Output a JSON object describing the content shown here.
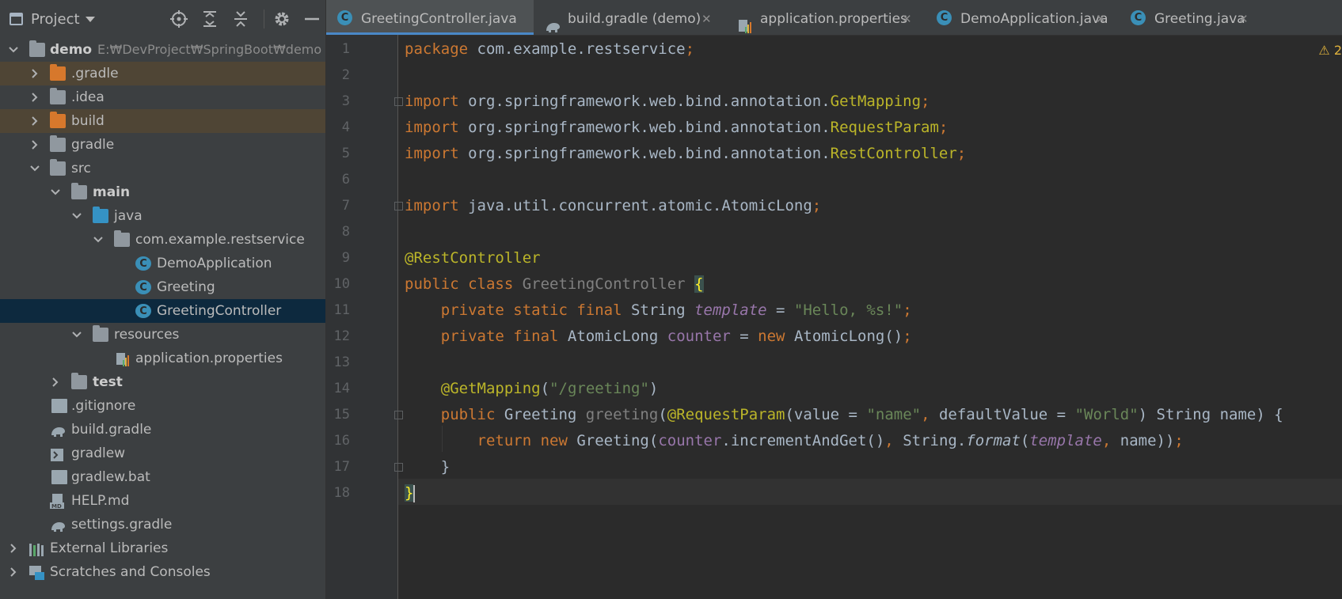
{
  "sidebar": {
    "title": "Project",
    "tree": [
      {
        "label": "demo",
        "sub": "E:₩DevProject₩SpringBoot₩demo",
        "bold": true
      },
      {
        "label": ".gradle"
      },
      {
        "label": ".idea"
      },
      {
        "label": "build"
      },
      {
        "label": "gradle"
      },
      {
        "label": "src"
      },
      {
        "label": "main",
        "bold": true
      },
      {
        "label": "java"
      },
      {
        "label": "com.example.restservice"
      },
      {
        "label": "DemoApplication"
      },
      {
        "label": "Greeting"
      },
      {
        "label": "GreetingController"
      },
      {
        "label": "resources"
      },
      {
        "label": "application.properties"
      },
      {
        "label": "test",
        "bold": true
      },
      {
        "label": ".gitignore"
      },
      {
        "label": "build.gradle"
      },
      {
        "label": "gradlew"
      },
      {
        "label": "gradlew.bat"
      },
      {
        "label": "HELP.md"
      },
      {
        "label": "settings.gradle"
      },
      {
        "label": "External Libraries"
      },
      {
        "label": "Scratches and Consoles"
      }
    ]
  },
  "tabs": [
    {
      "label": "GreetingController.java",
      "active": true
    },
    {
      "label": "build.gradle (demo)"
    },
    {
      "label": "application.properties"
    },
    {
      "label": "DemoApplication.java"
    },
    {
      "label": "Greeting.java"
    }
  ],
  "editor": {
    "warning_count": "2",
    "line_numbers": [
      "1",
      "2",
      "3",
      "4",
      "5",
      "6",
      "7",
      "8",
      "9",
      "10",
      "11",
      "12",
      "13",
      "14",
      "15",
      "16",
      "17",
      "18"
    ],
    "code": {
      "l1_kw": "package",
      "l1_rest": " com.example.restservice",
      "l1_semi": ";",
      "l3_kw": "import",
      "l3_pkg": " org.springframework.web.bind.annotation.",
      "l3_cls": "GetMapping",
      "l3_semi": ";",
      "l4_kw": "import",
      "l4_pkg": " org.springframework.web.bind.annotation.",
      "l4_cls": "RequestParam",
      "l4_semi": ";",
      "l5_kw": "import",
      "l5_pkg": " org.springframework.web.bind.annotation.",
      "l5_cls": "RestController",
      "l5_semi": ";",
      "l7_kw": "import",
      "l7_pkg": " java.util.concurrent.atomic.AtomicLong",
      "l7_semi": ";",
      "l9_ann": "@RestController",
      "l10_kw": "public class ",
      "l10_name": "GreetingController",
      "l10_sp": " ",
      "l10_brace": "{",
      "l11_kw": "private static final ",
      "l11_type": "String ",
      "l11_fld": "template",
      "l11_eq": " = ",
      "l11_str": "\"Hello, %s!\"",
      "l11_semi": ";",
      "l12_kw": "private final ",
      "l12_type": "AtomicLong ",
      "l12_fld": "counter",
      "l12_eq": " = ",
      "l12_new": "new ",
      "l12_ctor": "AtomicLong()",
      "l12_semi": ";",
      "l14_ann": "@GetMapping",
      "l14_p1": "(",
      "l14_str": "\"/greeting\"",
      "l14_p2": ")",
      "l15_kw": "public ",
      "l15_type": "Greeting ",
      "l15_name": "greeting",
      "l15_p1": "(",
      "l15_ann": "@RequestParam",
      "l15_p2": "(value = ",
      "l15_s1": "\"name\"",
      "l15_c1": ", ",
      "l15_p3": "defaultValue = ",
      "l15_s2": "\"World\"",
      "l15_p4": ") String name) {",
      "l16_kw": "return new ",
      "l16_a": "Greeting(",
      "l16_fld": "counter",
      "l16_b": ".incrementAndGet()",
      "l16_c": ", ",
      "l16_d": "String.",
      "l16_fmt": "format",
      "l16_e": "(",
      "l16_tpl": "template",
      "l16_f": ", ",
      "l16_g": "name))",
      "l16_semi": ";",
      "l17": "}",
      "l18": "}"
    }
  }
}
